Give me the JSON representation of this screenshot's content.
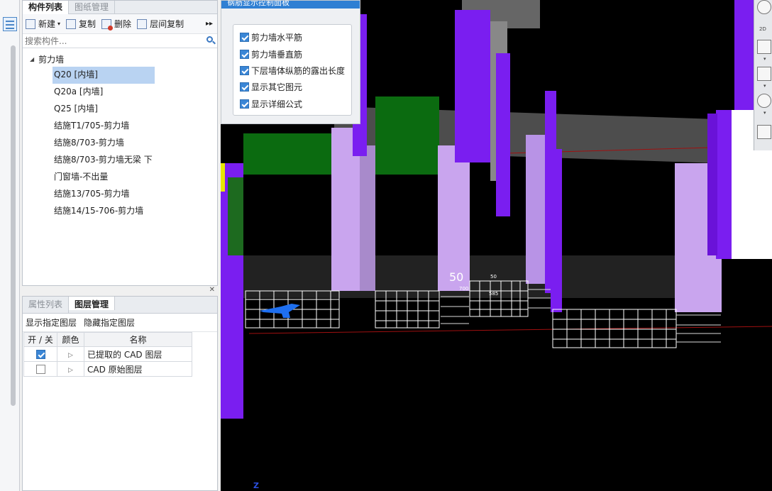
{
  "component_panel": {
    "tabs": [
      "构件列表",
      "图纸管理"
    ],
    "toolbar": {
      "new_label": "新建",
      "copy_label": "复制",
      "delete_label": "删除",
      "floor_copy_label": "层间复制",
      "more_glyph": "▸▸"
    },
    "search_placeholder": "搜索构件...",
    "tree_root": "剪力墙",
    "tree_items": [
      "Q20 [内墙]",
      "Q20a [内墙]",
      "Q25 [内墙]",
      "结施T1/705-剪力墙",
      "结施8/703-剪力墙",
      "结施8/703-剪力墙无梁 下",
      "门窗墙-不出量",
      "结施13/705-剪力墙",
      "结施14/15-706-剪力墙"
    ],
    "selected_index": 0
  },
  "layer_panel": {
    "tabs": [
      "属性列表",
      "图层管理"
    ],
    "actions": [
      "显示指定图层",
      "隐藏指定图层"
    ],
    "columns": [
      "开 / 关",
      "颜色",
      "名称"
    ],
    "rows": [
      {
        "checked": true,
        "name": "已提取的 CAD 图层"
      },
      {
        "checked": false,
        "name": "CAD 原始图层"
      }
    ],
    "close_glyph": "✕"
  },
  "rebar_panel": {
    "title": "钢筋显示控制面板",
    "options": [
      {
        "label": "剪力墙水平筋",
        "checked": true
      },
      {
        "label": "剪力墙垂直筋",
        "checked": true
      },
      {
        "label": "下层墙体纵筋的露出长度",
        "checked": true
      },
      {
        "label": "显示其它图元",
        "checked": true
      },
      {
        "label": "显示详细公式",
        "checked": true
      }
    ]
  },
  "viewport": {
    "dimension_label": "50",
    "small_labels": [
      "50",
      "700",
      "585"
    ],
    "axis_glyph": "Z"
  },
  "view_toolbar": {
    "mode_2d_label": "2D"
  },
  "colors": {
    "accent_blue": "#2f7fd3",
    "wall_purple": "#7a1ef0",
    "wall_lilac": "#c9a5ee",
    "beam_green": "#0b6b10",
    "rebar_white": "#ffffff"
  }
}
